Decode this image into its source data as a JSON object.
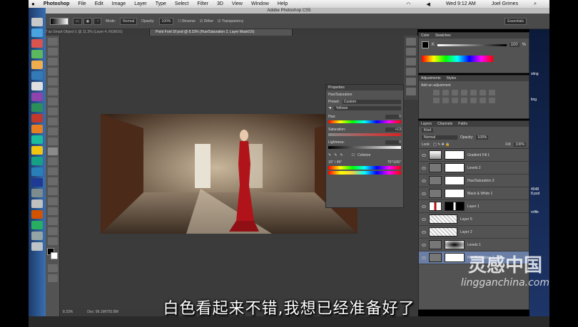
{
  "menubar": {
    "apple": "",
    "app_name": "Photoshop",
    "items": [
      "File",
      "Edit",
      "Image",
      "Layer",
      "Type",
      "Select",
      "Filter",
      "3D",
      "View",
      "Window",
      "Help"
    ],
    "clock": "Wed 9:12 AM",
    "user": "Joel Grimes"
  },
  "window_title": "Adobe Photoshop CS5",
  "options": {
    "mode_label": "Mode:",
    "mode_value": "Normal",
    "opacity_label": "Opacity:",
    "opacity_value": "100%",
    "reverse": "Reverse",
    "dither": "Dither",
    "transparency": "Transparency",
    "workspace": "Essentials"
  },
  "tabs": [
    {
      "label": "TIF_117 as Smart Object-1 @ 11.3% (Layer 4, RGB/16)"
    },
    {
      "label": "Point Font Sf pod @ 8.33% (Hue/Saturation 2, Layer Mask/16)"
    }
  ],
  "properties": {
    "title": "Properties",
    "subtitle": "Hue/Saturation",
    "preset_label": "Preset:",
    "preset_value": "Custom",
    "channel_value": "Yellows",
    "hue_label": "Hue:",
    "hue_value": "0",
    "saturation_label": "Saturation:",
    "saturation_value": "+13",
    "lightness_label": "Lightness:",
    "lightness_value": "0",
    "colorize_label": "Colorize",
    "range_left": "15° / 45°",
    "range_right": "75°\\105°"
  },
  "color_panel": {
    "tabs": [
      "Color",
      "Swatches"
    ],
    "k_label": "K",
    "k_value": "100",
    "k_unit": "%"
  },
  "adjustments": {
    "tabs": [
      "Adjustments",
      "Styles"
    ],
    "prompt": "Add an adjustment"
  },
  "layers": {
    "tabs": [
      "Layers",
      "Channels",
      "Paths"
    ],
    "kind": "Kind",
    "blend": "Normal",
    "opacity_label": "Opacity:",
    "opacity_value": "100%",
    "lock_label": "Lock:",
    "fill_label": "Fill:",
    "fill_value": "100%",
    "rows": [
      {
        "name": "Gradient Fill 1",
        "selected": false
      },
      {
        "name": "Levels 2",
        "selected": false
      },
      {
        "name": "Hue/Saturation 3",
        "selected": false
      },
      {
        "name": "Black & White 1",
        "selected": false
      },
      {
        "name": "Layer 1",
        "selected": false
      },
      {
        "name": "Layer 5",
        "selected": false
      },
      {
        "name": "Layer 2",
        "selected": false
      },
      {
        "name": "Levels 1",
        "selected": false
      },
      {
        "name": "Hue/Saturation 2",
        "selected": true
      }
    ]
  },
  "status": {
    "zoom": "8.33%",
    "doc": "Doc: 96.1M/792.8M"
  },
  "desktop_labels": [
    "sting",
    "ting",
    "4548",
    "8.psd",
    "rofile"
  ],
  "subtitle_text": "白色看起来不错,我想已经准备好了",
  "watermark_logo": "灵感中国",
  "watermark_url": "lingganchina.com",
  "colors": {
    "accent": "#6b7fa6",
    "panel": "#535353",
    "canvas": "#3b3b3b",
    "dress": "#b0141a"
  }
}
